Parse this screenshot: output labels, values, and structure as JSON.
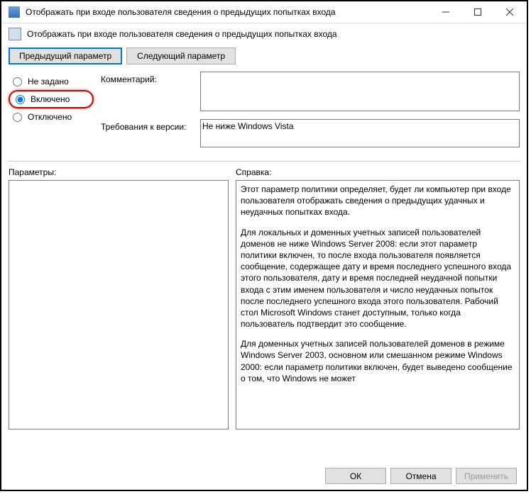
{
  "window": {
    "title": "Отображать при входе пользователя сведения о предыдущих попытках входа",
    "desc": "Отображать при входе пользователя сведения о предыдущих попытках входа"
  },
  "nav": {
    "prev": "Предыдущий параметр",
    "next": "Следующий параметр"
  },
  "radios": {
    "not_set": "Не задано",
    "enabled": "Включено",
    "disabled": "Отключено",
    "selected": "enabled"
  },
  "labels": {
    "comment": "Комментарий:",
    "requirements": "Требования к версии:",
    "params": "Параметры:",
    "help": "Справка:"
  },
  "fields": {
    "comment": "",
    "requirements": "Не ниже Windows Vista"
  },
  "help": {
    "p1": "Этот параметр политики определяет, будет ли компьютер при входе пользователя отображать сведения о предыдущих удачных и неудачных попытках входа.",
    "p2": "Для локальных и доменных учетных записей пользователей доменов не ниже Windows Server 2008: если этот параметр политики включен, то после входа пользователя появляется сообщение, содержащее дату и время последнего успешного входа этого пользователя, дату и время последней неудачной попытки входа с этим именем пользователя и число неудачных попыток после последнего успешного входа этого пользователя. Рабочий стол Microsoft Windows станет доступным, только когда пользователь подтвердит это сообщение.",
    "p3": "Для доменных учетных записей пользователей доменов в режиме Windows Server 2003, основном или смешанном режиме Windows 2000: если параметр политики включен, будет выведено сообщение о том, что Windows не может"
  },
  "footer": {
    "ok": "ОК",
    "cancel": "Отмена",
    "apply": "Применить"
  }
}
